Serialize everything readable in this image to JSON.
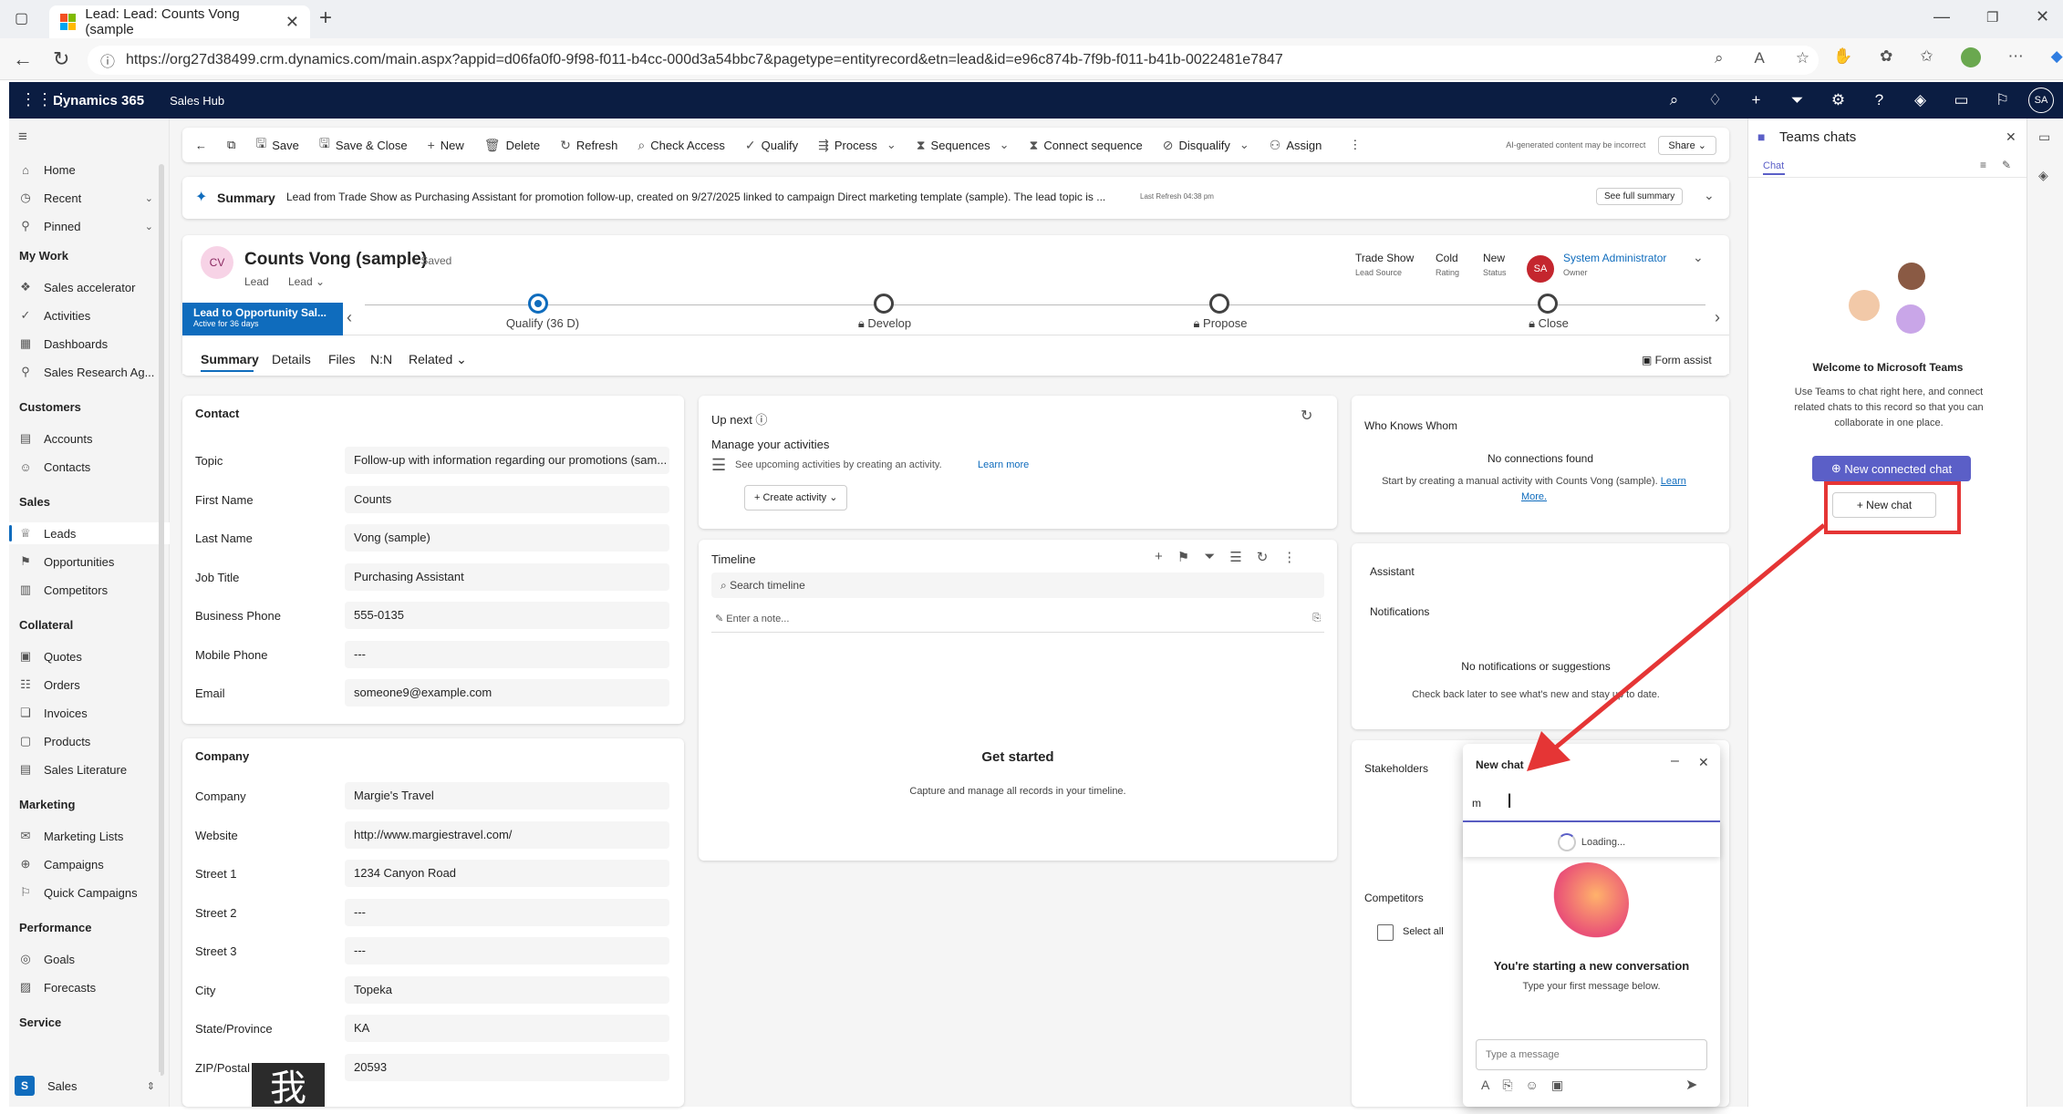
{
  "browser": {
    "tab_title": "Lead: Lead: Counts Vong (sample",
    "url": "https://org27d38499.crm.dynamics.com/main.aspx?appid=d06fa0f0-9f98-f011-b4cc-000d3a54bbc7&pagetype=entityrecord&etn=lead&id=e96c874b-7f9b-f011-b41b-0022481e7847"
  },
  "app": {
    "brand": "Dynamics 365",
    "hub": "Sales Hub",
    "avatar": "SA"
  },
  "sidebar": {
    "top": [
      {
        "label": "Home",
        "icon": "home-icon"
      },
      {
        "label": "Recent",
        "icon": "clock-icon"
      },
      {
        "label": "Pinned",
        "icon": "pin-icon"
      }
    ],
    "sections": [
      {
        "title": "My Work",
        "items": [
          "Sales accelerator",
          "Activities",
          "Dashboards",
          "Sales Research Ag..."
        ]
      },
      {
        "title": "Customers",
        "items": [
          "Accounts",
          "Contacts"
        ]
      },
      {
        "title": "Sales",
        "items": [
          "Leads",
          "Opportunities",
          "Competitors"
        ]
      },
      {
        "title": "Collateral",
        "items": [
          "Quotes",
          "Orders",
          "Invoices",
          "Products",
          "Sales Literature"
        ]
      },
      {
        "title": "Marketing",
        "items": [
          "Marketing Lists",
          "Campaigns",
          "Quick Campaigns"
        ]
      },
      {
        "title": "Performance",
        "items": [
          "Goals",
          "Forecasts"
        ]
      },
      {
        "title": "Service",
        "items": []
      }
    ],
    "area_badge": "S",
    "area_label": "Sales"
  },
  "commands": [
    "Save",
    "Save & Close",
    "New",
    "Delete",
    "Refresh",
    "Check Access",
    "Qualify",
    "Process",
    "Sequences",
    "Connect sequence",
    "Disqualify",
    "Assign"
  ],
  "ai_note": "AI-generated content may be incorrect",
  "share": "Share",
  "summary": {
    "label": "Summary",
    "text": "Lead from Trade Show as Purchasing Assistant for promotion follow-up, created on 9/27/2025 linked to campaign Direct marketing template (sample). The lead topic is ...",
    "refresh": "Last Refresh 04:38 pm",
    "full_button": "See full summary"
  },
  "record": {
    "initials": "CV",
    "name": "Counts Vong (sample)",
    "saved": "- Saved",
    "entity": "Lead",
    "form": "Lead",
    "lead_source": "Trade Show",
    "lead_source_label": "Lead Source",
    "rating": "Cold",
    "rating_label": "Rating",
    "status": "New",
    "status_label": "Status",
    "owner_initials": "SA",
    "owner": "System Administrator",
    "owner_label": "Owner"
  },
  "bpf": {
    "name": "Lead to Opportunity Sal...",
    "active": "Active for 36 days",
    "stages": [
      "Qualify (36 D)",
      "Develop",
      "Propose",
      "Close"
    ]
  },
  "tabs": [
    "Summary",
    "Details",
    "Files",
    "N:N",
    "Related"
  ],
  "form_assist": "Form assist",
  "contact": {
    "title": "Contact",
    "fields": [
      {
        "label": "Topic",
        "value": "Follow-up with information regarding our promotions (sam..."
      },
      {
        "label": "First Name",
        "value": "Counts"
      },
      {
        "label": "Last Name",
        "value": "Vong (sample)"
      },
      {
        "label": "Job Title",
        "value": "Purchasing Assistant"
      },
      {
        "label": "Business Phone",
        "value": "555-0135"
      },
      {
        "label": "Mobile Phone",
        "value": "---"
      },
      {
        "label": "Email",
        "value": "someone9@example.com"
      }
    ]
  },
  "company": {
    "title": "Company",
    "fields": [
      {
        "label": "Company",
        "value": "Margie's Travel"
      },
      {
        "label": "Website",
        "value": "http://www.margiestravel.com/"
      },
      {
        "label": "Street 1",
        "value": "1234 Canyon Road"
      },
      {
        "label": "Street 2",
        "value": "---"
      },
      {
        "label": "Street 3",
        "value": "---"
      },
      {
        "label": "City",
        "value": "Topeka"
      },
      {
        "label": "State/Province",
        "value": "KA"
      },
      {
        "label": "ZIP/Postal Code",
        "value": "20593"
      }
    ]
  },
  "upnext": {
    "title": "Up next",
    "manage": "Manage your activities",
    "hint": "See upcoming activities by creating an activity.",
    "learn": "Learn more",
    "create": "Create activity"
  },
  "timeline": {
    "title": "Timeline",
    "search": "Search timeline",
    "note": "Enter a note...",
    "started": "Get started",
    "started_sub": "Capture and manage all records in your timeline."
  },
  "whoknows": {
    "title": "Who Knows Whom",
    "none": "No connections found",
    "hint": "Start by creating a manual activity with Counts Vong (sample).",
    "learn": "Learn More."
  },
  "assistant": {
    "title": "Assistant",
    "notif": "Notifications",
    "none": "No notifications or suggestions",
    "hint": "Check back later to see what's new and stay up to date."
  },
  "stakeholders": "Stakeholders",
  "competitors": {
    "title": "Competitors",
    "select_all": "Select all"
  },
  "teams": {
    "title": "Teams chats",
    "tab": "Chat",
    "welcome": "Welcome to Microsoft Teams",
    "desc": "Use Teams to chat right here, and connect related chats to this record so that you can collaborate in one place.",
    "connected": "New connected chat",
    "new_chat": "New chat"
  },
  "chat_popup": {
    "title": "New chat",
    "input": "m",
    "loading": "Loading...",
    "starting": "You're starting a new conversation",
    "sub": "Type your first message below.",
    "placeholder": "Type a message"
  },
  "ime_glyph": "我",
  "colors": {
    "nav": "#0b1d42",
    "teams": "#5b5fc7",
    "highlight": "#e53535",
    "bpf": "#0f6cbd"
  }
}
